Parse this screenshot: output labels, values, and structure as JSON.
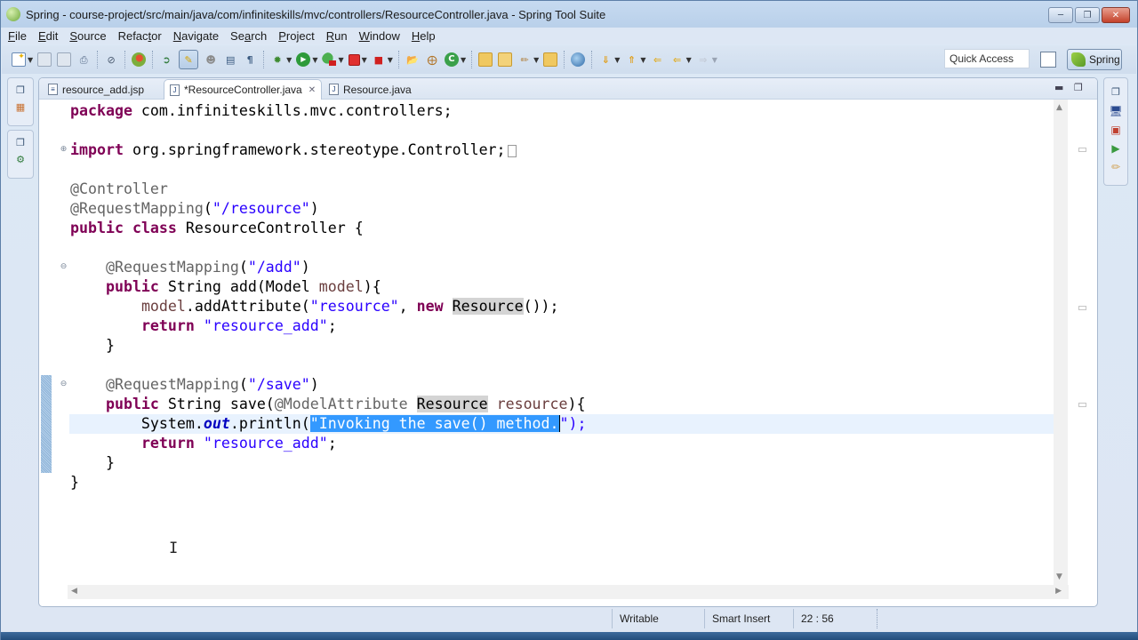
{
  "window": {
    "title": "Spring - course-project/src/main/java/com/infiniteskills/mvc/controllers/ResourceController.java - Spring Tool Suite",
    "app_icon": "spring-leaf-icon",
    "buttons": {
      "minimize": "minimize",
      "maximize": "maximize",
      "close": "close"
    }
  },
  "menubar": {
    "items": [
      {
        "label": "File",
        "mnemonic": "F"
      },
      {
        "label": "Edit",
        "mnemonic": "E"
      },
      {
        "label": "Source",
        "mnemonic": "S"
      },
      {
        "label": "Refactor",
        "mnemonic": "t"
      },
      {
        "label": "Navigate",
        "mnemonic": "N"
      },
      {
        "label": "Search",
        "mnemonic": "a"
      },
      {
        "label": "Project",
        "mnemonic": "P"
      },
      {
        "label": "Run",
        "mnemonic": "R"
      },
      {
        "label": "Window",
        "mnemonic": "W"
      },
      {
        "label": "Help",
        "mnemonic": "H"
      }
    ]
  },
  "toolbar": {
    "icons": [
      "new-icon",
      "save-icon",
      "save-all-icon",
      "print-icon",
      "skip-breakpoints-icon",
      "spring-dashboard-icon",
      "open-type-icon",
      "mark-occurrences-icon",
      "toggle-ant-icon",
      "block-selection-icon",
      "show-whitespace-icon",
      "debug-icon",
      "run-icon",
      "run-server-icon",
      "stop-icon",
      "external-tools-icon",
      "new-java-project-icon",
      "new-package-icon",
      "new-class-icon",
      "open-folder-icon",
      "open-file-icon",
      "search-tool-icon",
      "open-task-icon",
      "globe-icon",
      "next-annotation-icon",
      "previous-annotation-icon",
      "last-edit-icon",
      "back-icon",
      "forward-icon"
    ],
    "quick_access": "Quick Access",
    "perspective_label": "Spring"
  },
  "editor": {
    "tabs": [
      {
        "label": "resource_add.jsp",
        "icon": "jsp-file-icon",
        "active": false
      },
      {
        "label": "*ResourceController.java",
        "icon": "java-file-icon",
        "active": true
      },
      {
        "label": "Resource.java",
        "icon": "java-file-icon",
        "active": false
      }
    ],
    "code_lines": [
      "package com.infiniteskills.mvc.controllers;",
      "",
      "import org.springframework.stereotype.Controller;",
      "",
      "@Controller",
      "@RequestMapping(\"/resource\")",
      "public class ResourceController {",
      "",
      "    @RequestMapping(\"/add\")",
      "    public String add(Model model){",
      "        model.addAttribute(\"resource\", new Resource());",
      "        return \"resource_add\";",
      "    }",
      "",
      "    @RequestMapping(\"/save\")",
      "    public String save(@ModelAttribute Resource resource){",
      "        System.out.println(\"Invoking the save() method.\");",
      "        return \"resource_add\";",
      "    }",
      "}"
    ],
    "selected_text": "\"Invoking the save() method.",
    "current_line": 17
  },
  "status": {
    "writable": "Writable",
    "insert_mode": "Smart Insert",
    "position": "22 : 56"
  }
}
